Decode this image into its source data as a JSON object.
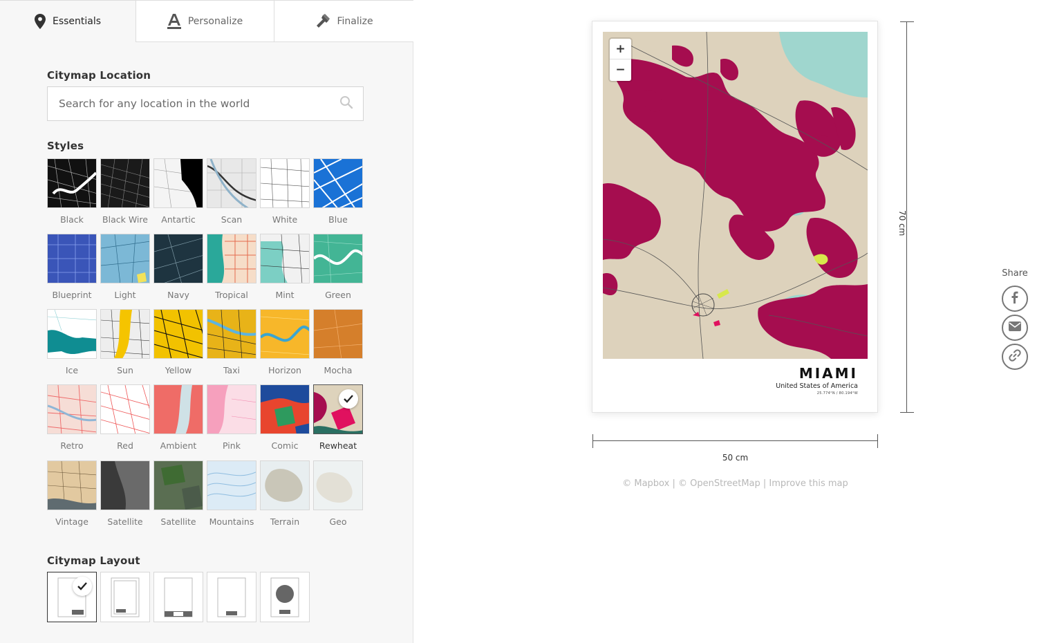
{
  "tabs": [
    {
      "label": "Essentials",
      "icon": "map-pin-icon",
      "active": true
    },
    {
      "label": "Personalize",
      "icon": "text-style-icon",
      "active": false
    },
    {
      "label": "Finalize",
      "icon": "hammer-icon",
      "active": false
    }
  ],
  "location": {
    "title": "Citymap Location",
    "placeholder": "Search for any location in the world"
  },
  "styles": {
    "title": "Styles",
    "selected": "Rewheat",
    "items": [
      "Black",
      "Black Wire",
      "Antartic",
      "Scan",
      "White",
      "Blue",
      "Blueprint",
      "Light",
      "Navy",
      "Tropical",
      "Mint",
      "Green",
      "Ice",
      "Sun",
      "Yellow",
      "Taxi",
      "Horizon",
      "Mocha",
      "Retro",
      "Red",
      "Ambient",
      "Pink",
      "Comic",
      "Rewheat",
      "Vintage",
      "Satellite",
      "Satellite",
      "Mountains",
      "Terrain",
      "Geo"
    ]
  },
  "layout": {
    "title": "Citymap Layout",
    "selected_index": 0,
    "count": 5
  },
  "poster": {
    "city": "MIAMI",
    "country": "United States of America",
    "coords": "25.774°N / 80.194°W",
    "zoom_in": "+",
    "zoom_out": "−"
  },
  "dimensions": {
    "height_label": "70 cm",
    "width_label": "50 cm"
  },
  "attribution": {
    "mapbox": "© Mapbox",
    "sep1": " | ",
    "osm": "© OpenStreetMap",
    "sep2": " | ",
    "improve": "Improve this map"
  },
  "share": {
    "title": "Share",
    "buttons": [
      "facebook-icon",
      "email-icon",
      "link-icon"
    ]
  },
  "colors": {
    "map_bg": "#ddd2bc",
    "map_urban": "#a50d4f",
    "map_water": "#9fd6ce",
    "map_accent": "#d7e84c"
  }
}
